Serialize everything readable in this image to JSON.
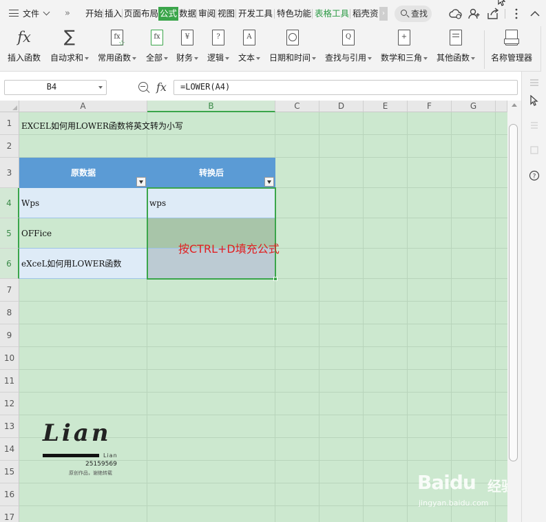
{
  "menubar": {
    "file_label": "文件",
    "more_label": "»",
    "tabs": [
      {
        "label": "开始"
      },
      {
        "label": "插入"
      },
      {
        "label": "页面布局"
      },
      {
        "label": "公式",
        "active": true
      },
      {
        "label": "数据"
      },
      {
        "label": "审阅"
      },
      {
        "label": "视图"
      },
      {
        "label": "开发工具"
      },
      {
        "label": "特色功能"
      },
      {
        "label": "表格工具"
      },
      {
        "label": "稻壳资"
      }
    ],
    "search_label": "查找",
    "accent_color": "#3aa54a"
  },
  "ribbon": {
    "items": [
      {
        "label": "插入函数",
        "icon": "fx-icon"
      },
      {
        "label": "自动求和",
        "icon": "sigma-icon",
        "dropdown": true
      },
      {
        "label": "常用函数",
        "icon": "common-function-icon",
        "dropdown": true
      },
      {
        "label": "全部",
        "icon": "all-functions-icon",
        "dropdown": true
      },
      {
        "label": "财务",
        "icon": "finance-icon",
        "dropdown": true
      },
      {
        "label": "逻辑",
        "icon": "logic-icon",
        "dropdown": true
      },
      {
        "label": "文本",
        "icon": "text-icon",
        "dropdown": true
      },
      {
        "label": "日期和时间",
        "icon": "clock-icon",
        "dropdown": true
      },
      {
        "label": "查找与引用",
        "icon": "lookup-icon",
        "dropdown": true
      },
      {
        "label": "数学和三角",
        "icon": "math-icon",
        "dropdown": true
      },
      {
        "label": "其他函数",
        "icon": "other-functions-icon",
        "dropdown": true
      },
      {
        "label": "名称管理器",
        "icon": "name-manager-icon"
      }
    ],
    "icon_glyphs": {
      "fx": "fx",
      "sigma": "∑",
      "common": "fx",
      "all": "fx",
      "finance": "¥",
      "logic": "?",
      "text": "A",
      "lookup": "Q",
      "math": "+"
    }
  },
  "formula_bar": {
    "cell_ref": "B4",
    "fx_label": "fx",
    "formula": "=LOWER(A4)"
  },
  "sheet": {
    "columns": [
      "A",
      "B",
      "C",
      "D",
      "E",
      "F",
      "G"
    ],
    "rows": [
      "1",
      "2",
      "3",
      "4",
      "5",
      "6",
      "7",
      "8",
      "9",
      "10",
      "11",
      "12",
      "13",
      "14",
      "15",
      "16",
      "17"
    ],
    "title": "EXCEL如何用LOWER函数将英文转为小写",
    "header_a": "原数据",
    "header_b": "转换后",
    "a4": "Wps",
    "b4": "wps",
    "a5": "OFFice",
    "a6": "eXceL如何用LOWER函数",
    "annotation": "按CTRL+D填充公式",
    "header_color": "#5b9bd5",
    "sheet_bg": "#cce8cf",
    "annotation_color": "#e02020"
  },
  "watermark": {
    "logo_word": "Lian",
    "logo_small": "Lian",
    "logo_number": "25159569",
    "logo_caption": "原创作品，谢绝转载",
    "baidu_text": "Baidu",
    "baidu_jingyan": "经验",
    "baidu_url": "jingyan.baidu.com"
  }
}
